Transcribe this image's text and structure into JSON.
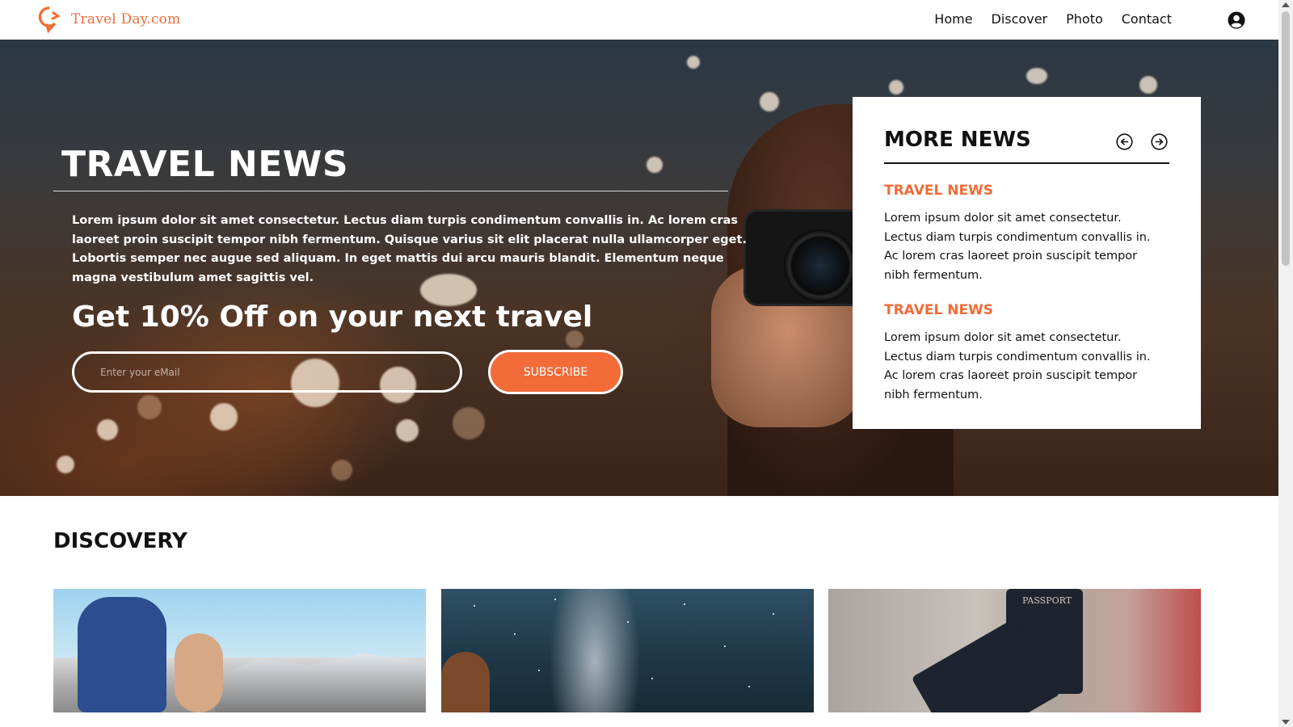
{
  "brand": {
    "name": "Travel Day.com",
    "accent_color": "#f26b38",
    "logo_icon": "location-pin-arrow-icon"
  },
  "nav": {
    "items": [
      {
        "label": "Home"
      },
      {
        "label": "Discover"
      },
      {
        "label": "Photo"
      },
      {
        "label": "Contact"
      }
    ],
    "user_icon": "user-circle-icon"
  },
  "hero": {
    "title": "TRAVEL NEWS",
    "description": "Lorem ipsum dolor sit amet consectetur. Lectus diam turpis condimentum convallis in. Ac lorem cras laoreet proin suscipit tempor nibh fermentum. Quisque varius sit elit placerat nulla ullamcorper eget. Lobortis semper nec augue sed aliquam. In eget mattis dui arcu mauris blandit. Elementum neque magna vestibulum amet sagittis vel.",
    "offer": "Get 10% Off on your next travel",
    "email_placeholder": "Enter your eMail",
    "subscribe_label": "SUBSCRIBE"
  },
  "more_news": {
    "title": "MORE NEWS",
    "prev_icon": "arrow-left-circle-icon",
    "next_icon": "arrow-right-circle-icon",
    "items": [
      {
        "title": "TRAVEL NEWS",
        "text": "Lorem ipsum dolor sit amet consectetur. Lectus diam turpis condimentum convallis in. Ac lorem cras laoreet proin suscipit tempor nibh fermentum."
      },
      {
        "title": "TRAVEL NEWS",
        "text": "Lorem ipsum dolor sit amet consectetur. Lectus diam turpis condimentum convallis in. Ac lorem cras laoreet proin suscipit tempor nibh fermentum."
      }
    ]
  },
  "discovery": {
    "title": "DISCOVERY",
    "cards": [
      {
        "image": "hiker-mountain-photo"
      },
      {
        "image": "milky-way-night-sky-photo"
      },
      {
        "image": "passports-city-photo",
        "caption_on_image": "PASSPORT"
      }
    ]
  }
}
